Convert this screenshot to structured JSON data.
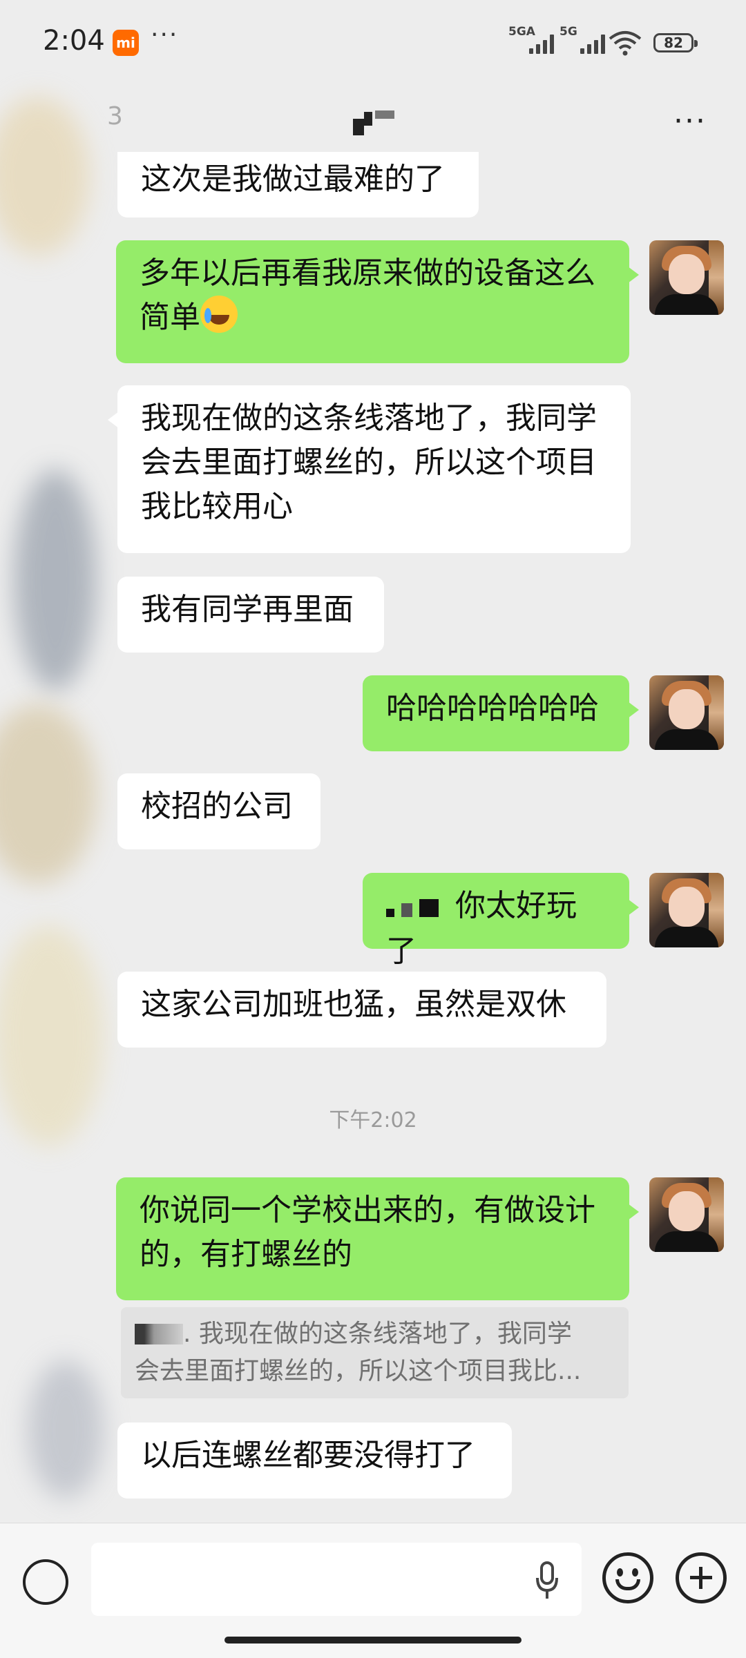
{
  "status_bar": {
    "time": "2:04",
    "notification_badge": "mi",
    "overflow_dots": "···",
    "signal_1_label": "5GA",
    "signal_2_label": "5G",
    "battery": "82"
  },
  "nav": {
    "unread_count": "3",
    "more_label": "···"
  },
  "messages": [
    {
      "side": "in",
      "text": "这次是我做过最难的了"
    },
    {
      "side": "out",
      "text_line1": "多年以后再看我原来做的设备这么",
      "text_line2": "简单",
      "emoji": "cry-laugh-emoji"
    },
    {
      "side": "in",
      "text": "我现在做的这条线落地了，我同学会去里面打螺丝的，所以这个项目我比较用心"
    },
    {
      "side": "in",
      "text": "我有同学再里面"
    },
    {
      "side": "out",
      "text": "哈哈哈哈哈哈哈"
    },
    {
      "side": "in",
      "text": "校招的公司"
    },
    {
      "side": "out",
      "text": "你太好玩了"
    },
    {
      "side": "in",
      "text": "这家公司加班也猛，虽然是双休"
    },
    {
      "side": "out",
      "text": "你说同一个学校出来的，有做设计的，有打螺丝的"
    },
    {
      "side": "in",
      "text": "以后连螺丝都要没得打了"
    }
  ],
  "timestamp": "下午2:02",
  "quote": {
    "line1": ". 我现在做的这条线落地了，我同学",
    "line2": "会去里面打螺丝的，所以这个项目我比..."
  },
  "colors": {
    "background": "#ededed",
    "outgoing_bubble": "#95ec69",
    "incoming_bubble": "#ffffff",
    "timestamp": "#9a9a9a"
  }
}
